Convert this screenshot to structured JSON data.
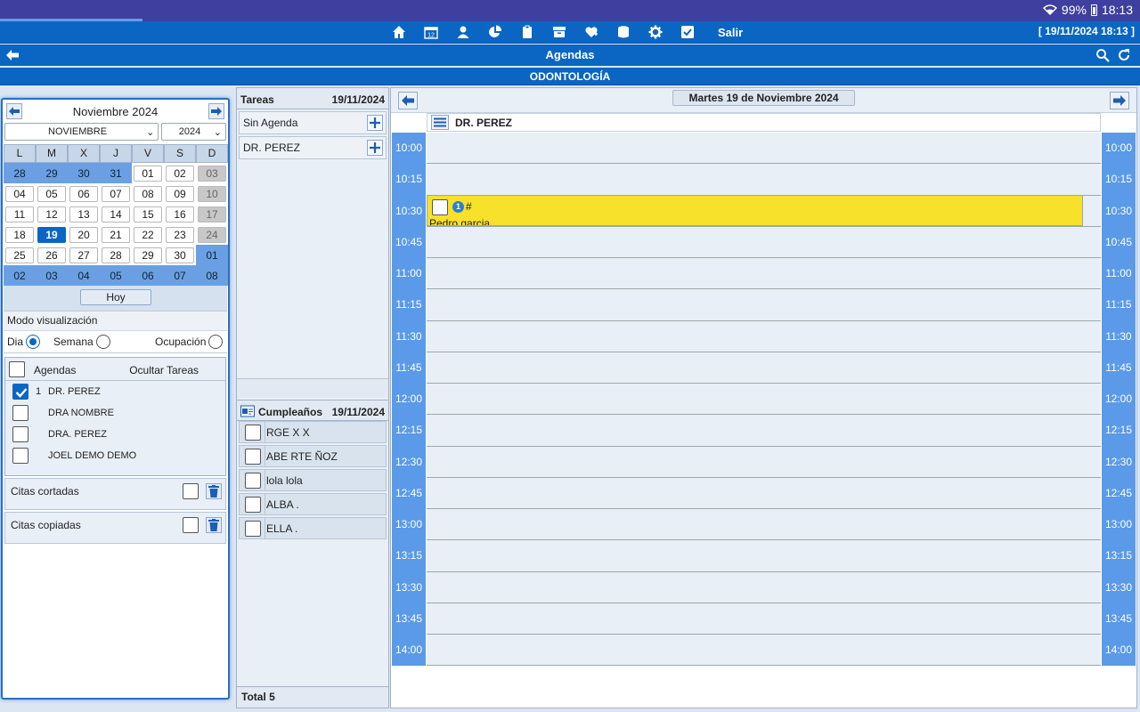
{
  "status_bar": {
    "battery": "99%",
    "time": "18:13"
  },
  "toolbar": {
    "icons": [
      "home-icon",
      "calendar-icon",
      "person-icon",
      "pie-chart-icon",
      "clipboard-icon",
      "inbox-icon",
      "heart-plus-icon",
      "database-icon",
      "gear-icon",
      "checkbox-icon"
    ],
    "salir": "Salir",
    "datetime": "[ 19/11/2024 18:13 ]"
  },
  "titlebar": {
    "title": "Agendas"
  },
  "subtitle": "ODONTOLOGÍA",
  "calendar": {
    "month_title": "Noviembre 2024",
    "month_select": "NOVIEMBRE",
    "year_select": "2024",
    "dow": [
      "L",
      "M",
      "X",
      "J",
      "V",
      "S",
      "D"
    ],
    "weeks": [
      [
        {
          "d": "28",
          "t": "outside"
        },
        {
          "d": "29",
          "t": "outside"
        },
        {
          "d": "30",
          "t": "outside"
        },
        {
          "d": "31",
          "t": "outside"
        },
        {
          "d": "01",
          "t": "normal"
        },
        {
          "d": "02",
          "t": "normal"
        },
        {
          "d": "03",
          "t": "weekend"
        }
      ],
      [
        {
          "d": "04",
          "t": "normal"
        },
        {
          "d": "05",
          "t": "normal"
        },
        {
          "d": "06",
          "t": "normal"
        },
        {
          "d": "07",
          "t": "normal"
        },
        {
          "d": "08",
          "t": "normal"
        },
        {
          "d": "09",
          "t": "normal"
        },
        {
          "d": "10",
          "t": "weekend"
        }
      ],
      [
        {
          "d": "11",
          "t": "normal"
        },
        {
          "d": "12",
          "t": "normal"
        },
        {
          "d": "13",
          "t": "normal"
        },
        {
          "d": "14",
          "t": "normal"
        },
        {
          "d": "15",
          "t": "normal"
        },
        {
          "d": "16",
          "t": "normal"
        },
        {
          "d": "17",
          "t": "weekend"
        }
      ],
      [
        {
          "d": "18",
          "t": "normal"
        },
        {
          "d": "19",
          "t": "today"
        },
        {
          "d": "20",
          "t": "normal"
        },
        {
          "d": "21",
          "t": "normal"
        },
        {
          "d": "22",
          "t": "normal"
        },
        {
          "d": "23",
          "t": "normal"
        },
        {
          "d": "24",
          "t": "weekend"
        }
      ],
      [
        {
          "d": "25",
          "t": "normal"
        },
        {
          "d": "26",
          "t": "normal"
        },
        {
          "d": "27",
          "t": "normal"
        },
        {
          "d": "28",
          "t": "normal"
        },
        {
          "d": "29",
          "t": "normal"
        },
        {
          "d": "30",
          "t": "normal"
        },
        {
          "d": "01",
          "t": "outside"
        }
      ],
      [
        {
          "d": "02",
          "t": "outside"
        },
        {
          "d": "03",
          "t": "outside"
        },
        {
          "d": "04",
          "t": "outside"
        },
        {
          "d": "05",
          "t": "outside"
        },
        {
          "d": "06",
          "t": "outside"
        },
        {
          "d": "07",
          "t": "outside"
        },
        {
          "d": "08",
          "t": "outside"
        }
      ]
    ],
    "hoy": "Hoy"
  },
  "modo": {
    "label": "Modo visualización",
    "options": [
      {
        "label": "Dia",
        "selected": true
      },
      {
        "label": "Semana",
        "selected": false
      },
      {
        "label": "Ocupación",
        "selected": false
      }
    ]
  },
  "agendas": {
    "label": "Agendas",
    "ocultar": "Ocultar Tareas",
    "items": [
      {
        "num": "1",
        "name": "DR. PEREZ",
        "checked": true
      },
      {
        "num": "",
        "name": "DRA NOMBRE",
        "checked": false
      },
      {
        "num": "",
        "name": "DRA. PEREZ",
        "checked": false
      },
      {
        "num": "",
        "name": "JOEL DEMO DEMO",
        "checked": false
      }
    ]
  },
  "citas_cortadas": "Citas cortadas",
  "citas_copiadas": "Citas copiadas",
  "tareas": {
    "title": "Tareas",
    "date": "19/11/2024",
    "rows": [
      "Sin Agenda",
      "DR. PEREZ"
    ]
  },
  "cumpleanos": {
    "title": "Cumpleaños",
    "date": "19/11/2024",
    "rows": [
      "RGE X X",
      "ABE RTE ÑOZ",
      "lola lola",
      "ALBA .",
      "ELLA ."
    ],
    "total": "Total 5"
  },
  "agenda_view": {
    "date_title": "Martes 19 de Noviembre 2024",
    "doctor": "DR. PEREZ",
    "times": [
      "10:00",
      "10:15",
      "10:30",
      "10:45",
      "11:00",
      "11:15",
      "11:30",
      "11:45",
      "12:00",
      "12:15",
      "12:30",
      "12:45",
      "13:00",
      "13:15",
      "13:30",
      "13:45",
      "14:00"
    ],
    "appointment": {
      "time": "10:30",
      "badge": "1",
      "mark": "#",
      "patient": "Pedro garcia",
      "color": "#f7e12a"
    }
  }
}
